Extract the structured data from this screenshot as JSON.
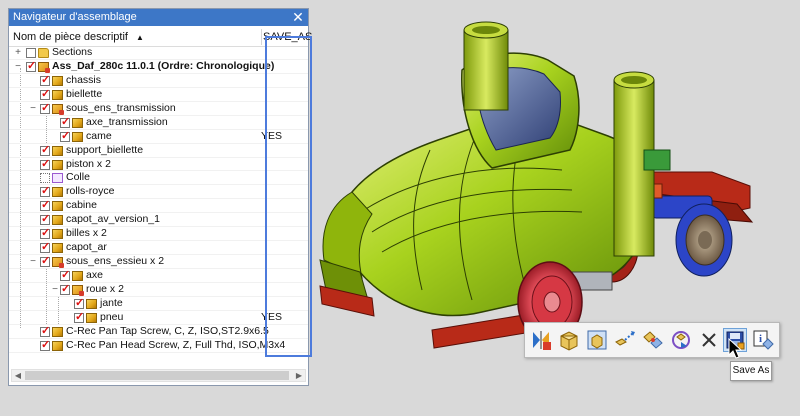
{
  "navigator": {
    "title": "Navigateur d'assemblage",
    "col_name": "Nom de pièce descriptif",
    "col_save": "SAVE_AS",
    "rows": [
      {
        "label": "Sections",
        "value": ""
      },
      {
        "label": "Ass_Daf_280c 11.0.1 (Ordre: Chronologique)",
        "value": ""
      },
      {
        "label": "chassis",
        "value": ""
      },
      {
        "label": "biellette",
        "value": ""
      },
      {
        "label": "sous_ens_transmission",
        "value": ""
      },
      {
        "label": "axe_transmission",
        "value": ""
      },
      {
        "label": "came",
        "value": "YES"
      },
      {
        "label": "support_biellette",
        "value": ""
      },
      {
        "label": "piston x 2",
        "value": ""
      },
      {
        "label": "Colle",
        "value": ""
      },
      {
        "label": "rolls-royce",
        "value": ""
      },
      {
        "label": "cabine",
        "value": ""
      },
      {
        "label": "capot_av_version_1",
        "value": ""
      },
      {
        "label": "billes x 2",
        "value": ""
      },
      {
        "label": "capot_ar",
        "value": ""
      },
      {
        "label": "sous_ens_essieu x 2",
        "value": ""
      },
      {
        "label": "axe",
        "value": ""
      },
      {
        "label": "roue x 2",
        "value": ""
      },
      {
        "label": "jante",
        "value": ""
      },
      {
        "label": "pneu",
        "value": "YES"
      },
      {
        "label": "C-Rec Pan Tap Screw, C, Z, ISO,ST2.9x6.5",
        "value": ""
      },
      {
        "label": "C-Rec Pan Head Screw, Z, Full Thd, ISO,M3x4",
        "value": ""
      }
    ]
  },
  "toolbar": {
    "buttons": [
      "mirror-assembly-icon",
      "component-icon",
      "assembly-view-icon",
      "move-component-icon",
      "constraint-icon",
      "replace-component-icon",
      "close-icon",
      "save-as-icon",
      "properties-icon"
    ],
    "tooltip": "Save As"
  },
  "colors": {
    "title_bar": "#3d77c7",
    "highlight_box": "#4d7bdc",
    "body_green": "#a8d21e",
    "chassis_red": "#c9321f",
    "tire_red": "#e04b57",
    "axle_blue": "#2c45c8",
    "background": "#d9d9d9"
  }
}
